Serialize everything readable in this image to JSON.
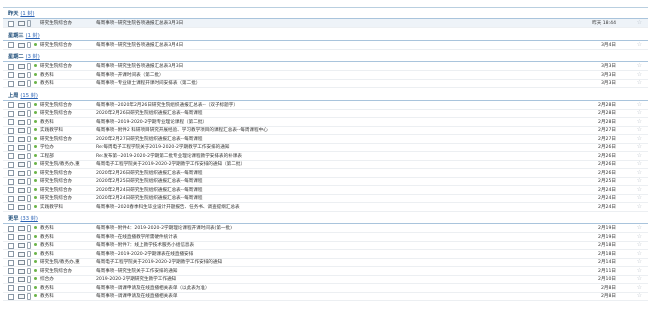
{
  "groups": [
    {
      "label": "昨天",
      "count": "(1 封)",
      "rows": [
        {
          "sender": "研究生院综合办",
          "subject": "每周事项--研究生院各项通报汇总表3月3日",
          "date": "昨天 18:44",
          "dot": false
        }
      ]
    },
    {
      "label": "星期三",
      "count": "(1 封)",
      "rows": [
        {
          "sender": "研究生院综合办",
          "subject": "每周事项--研究生院各项通报汇总表3月4日",
          "date": "3月4日",
          "dot": true
        }
      ]
    },
    {
      "label": "星期二",
      "count": "(3 封)",
      "rows": [
        {
          "sender": "研究生院综合办",
          "subject": "每周事项--研究生院各项通报汇总表3月3日",
          "date": "3月3日",
          "dot": true
        },
        {
          "sender": "教务科",
          "subject": "每周事项--开课时间表（第二批）",
          "date": "3月3日",
          "dot": true
        },
        {
          "sender": "教务科",
          "subject": "每周事项--专业硕士课程开课时间安排表（第二批）",
          "date": "3月3日",
          "dot": true
        }
      ]
    },
    {
      "label": "上周",
      "count": "(15 封)",
      "rows": [
        {
          "sender": "研究生院综合办",
          "subject": "每周事项--2020年2月26日研究生院组织通报汇总表--（双子标题字）",
          "date": "2月28日",
          "dot": true
        },
        {
          "sender": "研究生院综合办",
          "subject": "2020年2月26日研究生院组织通报汇总表--每周课程",
          "date": "2月28日",
          "dot": true
        },
        {
          "sender": "教务科",
          "subject": "每周事项--2019-2020-2学期专业理论课程（第二批）",
          "date": "2月28日",
          "dot": true
        },
        {
          "sender": "实践教学科",
          "subject": "每周事项--附件2 科研项目研究开展经验、学习教学项目的课程汇总表--每周课程中心",
          "date": "2月27日",
          "dot": true
        },
        {
          "sender": "研究生院综合办",
          "subject": "2020年2月27日研究生院组织通报汇总表--每周课程",
          "date": "2月27日",
          "dot": true
        },
        {
          "sender": "学位办",
          "subject": "Re:每周电子工程学院关于2019-2020-2学期教学工作安排的通知",
          "date": "2月26日",
          "dot": true
        },
        {
          "sender": "工程部",
          "subject": "Re:发布第--2019-2020-2学期第二批专业理论课程教学安排表的补课表",
          "date": "2月26日",
          "dot": true
        },
        {
          "sender": "研究生院/教务办,重",
          "subject": "每周电子工程学院关于2019-2020-2学期教学工作安排的通知（第二批）",
          "date": "2月26日",
          "dot": true
        },
        {
          "sender": "研究生院综合办",
          "subject": "2020年2月26日研究生院组织通报汇总表--每周课程",
          "date": "2月26日",
          "dot": true
        },
        {
          "sender": "研究生院综合办",
          "subject": "2020年2月25日研究生院组织通报汇总表--每周课程",
          "date": "2月25日",
          "dot": true
        },
        {
          "sender": "研究生院综合办",
          "subject": "2020年2月24日研究生院组织通报汇总表--每周课程",
          "date": "2月24日",
          "dot": true
        },
        {
          "sender": "研究生院综合办",
          "subject": "2020年2月24日研究生院组织通报汇总表--每周课程",
          "date": "2月24日",
          "dot": true
        },
        {
          "sender": "实践教学科",
          "subject": "每周事项--2020春季科生毕业设计开题报告、任务书、调查提纲汇总表",
          "date": "2月24日",
          "dot": true
        }
      ]
    },
    {
      "label": "更早",
      "count": "(33 封)",
      "rows": [
        {
          "sender": "教务科",
          "subject": "每周事项--附件4：2019-2020-2学期理论课程开课时间表(第一批)",
          "date": "2月19日",
          "dot": true
        },
        {
          "sender": "教务科",
          "subject": "每周事项--在线直播教学所需硬件统计表",
          "date": "2月19日",
          "dot": true
        },
        {
          "sender": "教务科",
          "subject": "每周事项--附件7：线上教学技术服务小组信息表",
          "date": "2月18日",
          "dot": true
        },
        {
          "sender": "教务科",
          "subject": "每周事项--2019-2020-2学期课表在线直播安排",
          "date": "2月18日",
          "dot": true
        },
        {
          "sender": "研究生院/教务办,重",
          "subject": "每周电子工程学院关于2019-2020-2学期教学工作安排的通知",
          "date": "2月14日",
          "dot": true
        },
        {
          "sender": "研究生院综合办",
          "subject": "每周事项--研究生院关于工作安排的通知",
          "date": "2月11日",
          "dot": true
        },
        {
          "sender": "综合办",
          "subject": "2019-2020-2学期研究生教学工作通知",
          "date": "2月10日",
          "dot": true
        },
        {
          "sender": "教务科",
          "subject": "每周事项--调课申请及在线直播相关表单（以此表为准）",
          "date": "2月8日",
          "dot": true
        },
        {
          "sender": "教务科",
          "subject": "每周事项--调课申请及在线直播相关表单",
          "date": "2月8日",
          "dot": true
        }
      ]
    }
  ]
}
